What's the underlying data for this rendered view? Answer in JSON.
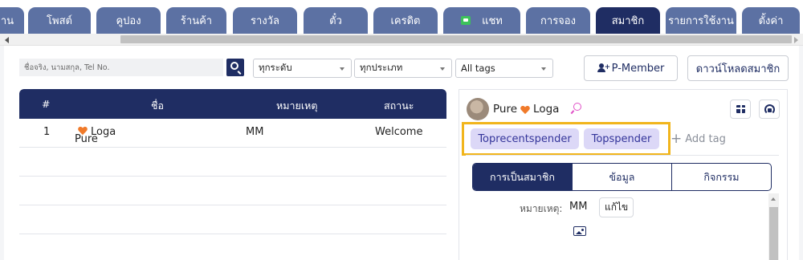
{
  "tabs": [
    {
      "label": "าน"
    },
    {
      "label": "โพสต์"
    },
    {
      "label": "คูปอง"
    },
    {
      "label": "ร้านค้า"
    },
    {
      "label": "รางวัล"
    },
    {
      "label": "ตั๋ว"
    },
    {
      "label": "เครดิต"
    },
    {
      "label": "แชท",
      "icon": "chat-icon"
    },
    {
      "label": "การจอง"
    },
    {
      "label": "สมาชิก",
      "active": true
    },
    {
      "label": "รายการใช้งาน"
    },
    {
      "label": "ตั้งค่า"
    }
  ],
  "filters": {
    "search_placeholder": "ชื่อจริง, นามสกุล, Tel No.",
    "level_select": "ทุกระดับ",
    "type_select": "ทุกประเภท",
    "tags_select": "All tags",
    "pmember_label": "P-Member",
    "download_label": "ดาวน์โหลดสมาชิก"
  },
  "table": {
    "headers": [
      "#",
      "ชื่อ",
      "หมายเหตุ",
      "สถานะ"
    ],
    "rows": [
      {
        "no": "1",
        "first": "Pure",
        "last": "Loga",
        "note": "MM",
        "status": "Welcome"
      }
    ]
  },
  "member": {
    "first": "Pure",
    "last": "Loga",
    "tags": [
      "Toprecentspender",
      "Topspender"
    ],
    "add_tag_label": "Add tag",
    "segments": [
      "การเป็นสมาชิก",
      "ข้อมูล",
      "กิจกรรม"
    ],
    "active_segment": "การเป็นสมาชิก",
    "note_label": "หมายเหตุ:",
    "note_value": "MM",
    "edit_label": "แก้ไข"
  },
  "colors": {
    "primary": "#1f2d63",
    "tab": "#5c71a3",
    "tag_bg": "#dcd8f7",
    "highlight": "#f1b51c",
    "heart": "#f07a2a"
  }
}
